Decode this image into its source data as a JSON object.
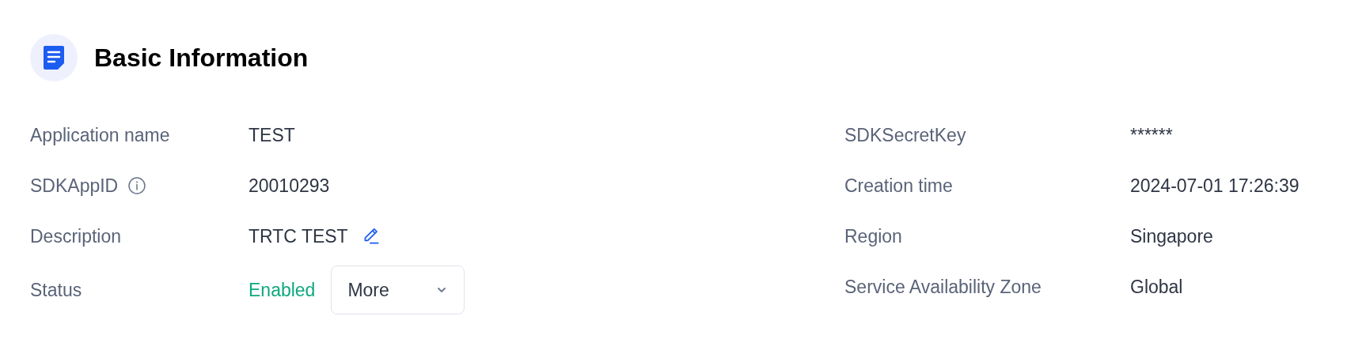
{
  "section": {
    "title": "Basic Information"
  },
  "left_fields": [
    {
      "label": "Application name",
      "kind": "text",
      "value": "TEST"
    },
    {
      "label": "SDKAppID",
      "kind": "text",
      "value": "20010293",
      "info": true
    },
    {
      "label": "Description",
      "kind": "editable",
      "value": "TRTC TEST"
    },
    {
      "label": "Status",
      "kind": "status",
      "value": "Enabled",
      "button": "More"
    }
  ],
  "right_fields": [
    {
      "label": "SDKSecretKey",
      "kind": "text",
      "value": "******"
    },
    {
      "label": "Creation time",
      "kind": "text",
      "value": "2024-07-01 17:26:39"
    },
    {
      "label": "Region",
      "kind": "text",
      "value": "Singapore"
    },
    {
      "label": "Service Availability Zone",
      "kind": "text",
      "value": "Global"
    }
  ]
}
